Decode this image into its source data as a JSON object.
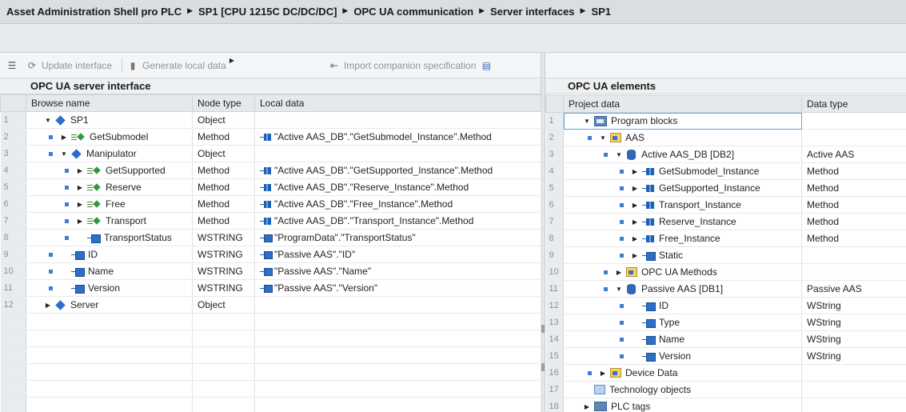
{
  "breadcrumb": [
    "Asset Administration Shell pro PLC",
    "SP1 [CPU 1215C DC/DC/DC]",
    "OPC UA communication",
    "Server interfaces",
    "SP1"
  ],
  "toolbar": {
    "update_interface": "Update interface",
    "generate_local_data": "Generate local data",
    "import_companion": "Import companion specification"
  },
  "left_panel": {
    "title": "OPC UA server interface",
    "columns": [
      "Browse name",
      "Node type",
      "Local data"
    ],
    "rows": [
      {
        "n": "1",
        "name": "SP1",
        "type": "Object",
        "local": "",
        "icon": "object",
        "arrow": "expanded",
        "indent": 0,
        "bullet": false
      },
      {
        "n": "2",
        "name": "GetSubmodel",
        "type": "Method",
        "local": "\"Active AAS_DB\".\"GetSubmodel_Instance\".Method",
        "icon": "method",
        "arrow": "collapsed",
        "indent": 1,
        "bullet": true,
        "local_icon": "method"
      },
      {
        "n": "3",
        "name": "Manipulator",
        "type": "Object",
        "local": "",
        "icon": "object",
        "arrow": "expanded",
        "indent": 1,
        "bullet": true
      },
      {
        "n": "4",
        "name": "GetSupported",
        "type": "Method",
        "local": "\"Active AAS_DB\".\"GetSupported_Instance\".Method",
        "icon": "method",
        "arrow": "collapsed",
        "indent": 2,
        "bullet": true,
        "local_icon": "method"
      },
      {
        "n": "5",
        "name": "Reserve",
        "type": "Method",
        "local": "\"Active AAS_DB\".\"Reserve_Instance\".Method",
        "icon": "method",
        "arrow": "collapsed",
        "indent": 2,
        "bullet": true,
        "local_icon": "method"
      },
      {
        "n": "6",
        "name": "Free",
        "type": "Method",
        "local": "\"Active AAS_DB\".\"Free_Instance\".Method",
        "icon": "method",
        "arrow": "collapsed",
        "indent": 2,
        "bullet": true,
        "local_icon": "method"
      },
      {
        "n": "7",
        "name": "Transport",
        "type": "Method",
        "local": "\"Active AAS_DB\".\"Transport_Instance\".Method",
        "icon": "method",
        "arrow": "collapsed",
        "indent": 2,
        "bullet": true,
        "local_icon": "method"
      },
      {
        "n": "8",
        "name": "TransportStatus",
        "type": "WSTRING",
        "local": "\"ProgramData\".\"TransportStatus\"",
        "icon": "variable",
        "arrow": "none",
        "indent": 2,
        "bullet": true,
        "local_icon": "variable"
      },
      {
        "n": "9",
        "name": "ID",
        "type": "WSTRING",
        "local": "\"Passive AAS\".\"ID\"",
        "icon": "variable",
        "arrow": "none",
        "indent": 1,
        "bullet": true,
        "local_icon": "variable"
      },
      {
        "n": "10",
        "name": "Name",
        "type": "WSTRING",
        "local": "\"Passive AAS\".\"Name\"",
        "icon": "variable",
        "arrow": "none",
        "indent": 1,
        "bullet": true,
        "local_icon": "variable"
      },
      {
        "n": "11",
        "name": "Version",
        "type": "WSTRING",
        "local": "\"Passive AAS\".\"Version\"",
        "icon": "variable",
        "arrow": "none",
        "indent": 1,
        "bullet": true,
        "local_icon": "variable"
      },
      {
        "n": "12",
        "name": "Server",
        "type": "Object",
        "local": "",
        "icon": "object",
        "arrow": "collapsed",
        "indent": 0,
        "bullet": false
      }
    ]
  },
  "right_panel": {
    "title": "OPC UA elements",
    "columns": [
      "Project data",
      "Data type"
    ],
    "rows": [
      {
        "n": "1",
        "name": "Program blocks",
        "type": "",
        "icon": "program",
        "arrow": "expanded",
        "indent": 0,
        "bullet": false,
        "selected": true
      },
      {
        "n": "2",
        "name": "AAS",
        "type": "",
        "icon": "folder",
        "arrow": "expanded",
        "indent": 1,
        "bullet": true
      },
      {
        "n": "3",
        "name": "Active AAS_DB [DB2]",
        "type": "Active AAS",
        "icon": "db",
        "arrow": "expanded",
        "indent": 2,
        "bullet": true
      },
      {
        "n": "4",
        "name": "GetSubmodel_Instance",
        "type": "Method",
        "icon": "fb",
        "arrow": "collapsed",
        "indent": 3,
        "bullet": true
      },
      {
        "n": "5",
        "name": "GetSupported_Instance",
        "type": "Method",
        "icon": "fb",
        "arrow": "collapsed",
        "indent": 3,
        "bullet": true
      },
      {
        "n": "6",
        "name": "Transport_Instance",
        "type": "Method",
        "icon": "fb",
        "arrow": "collapsed",
        "indent": 3,
        "bullet": true
      },
      {
        "n": "7",
        "name": "Reserve_Instance",
        "type": "Method",
        "icon": "fb",
        "arrow": "collapsed",
        "indent": 3,
        "bullet": true
      },
      {
        "n": "8",
        "name": "Free_Instance",
        "type": "Method",
        "icon": "fb",
        "arrow": "collapsed",
        "indent": 3,
        "bullet": true
      },
      {
        "n": "9",
        "name": "Static",
        "type": "",
        "icon": "variable",
        "arrow": "collapsed",
        "indent": 3,
        "bullet": true
      },
      {
        "n": "10",
        "name": "OPC UA Methods",
        "type": "",
        "icon": "folder",
        "arrow": "collapsed",
        "indent": 2,
        "bullet": true
      },
      {
        "n": "11",
        "name": "Passive AAS [DB1]",
        "type": "Passive AAS",
        "icon": "db",
        "arrow": "expanded",
        "indent": 2,
        "bullet": true
      },
      {
        "n": "12",
        "name": "ID",
        "type": "WString",
        "icon": "variable",
        "arrow": "none",
        "indent": 3,
        "bullet": true
      },
      {
        "n": "13",
        "name": "Type",
        "type": "WString",
        "icon": "variable",
        "arrow": "none",
        "indent": 3,
        "bullet": true
      },
      {
        "n": "14",
        "name": "Name",
        "type": "WString",
        "icon": "variable",
        "arrow": "none",
        "indent": 3,
        "bullet": true
      },
      {
        "n": "15",
        "name": "Version",
        "type": "WString",
        "icon": "variable",
        "arrow": "none",
        "indent": 3,
        "bullet": true
      },
      {
        "n": "16",
        "name": "Device Data",
        "type": "",
        "icon": "folder",
        "arrow": "collapsed",
        "indent": 1,
        "bullet": true
      },
      {
        "n": "17",
        "name": "Technology objects",
        "type": "",
        "icon": "tech",
        "arrow": "none",
        "indent": 0,
        "bullet": false
      },
      {
        "n": "18",
        "name": "PLC tags",
        "type": "",
        "icon": "tags",
        "arrow": "collapsed",
        "indent": 0,
        "bullet": false
      }
    ]
  },
  "colors": {
    "accent_blue": "#3b7fd0",
    "header_bg": "#d9dee3",
    "method_green": "#2f9a45"
  }
}
